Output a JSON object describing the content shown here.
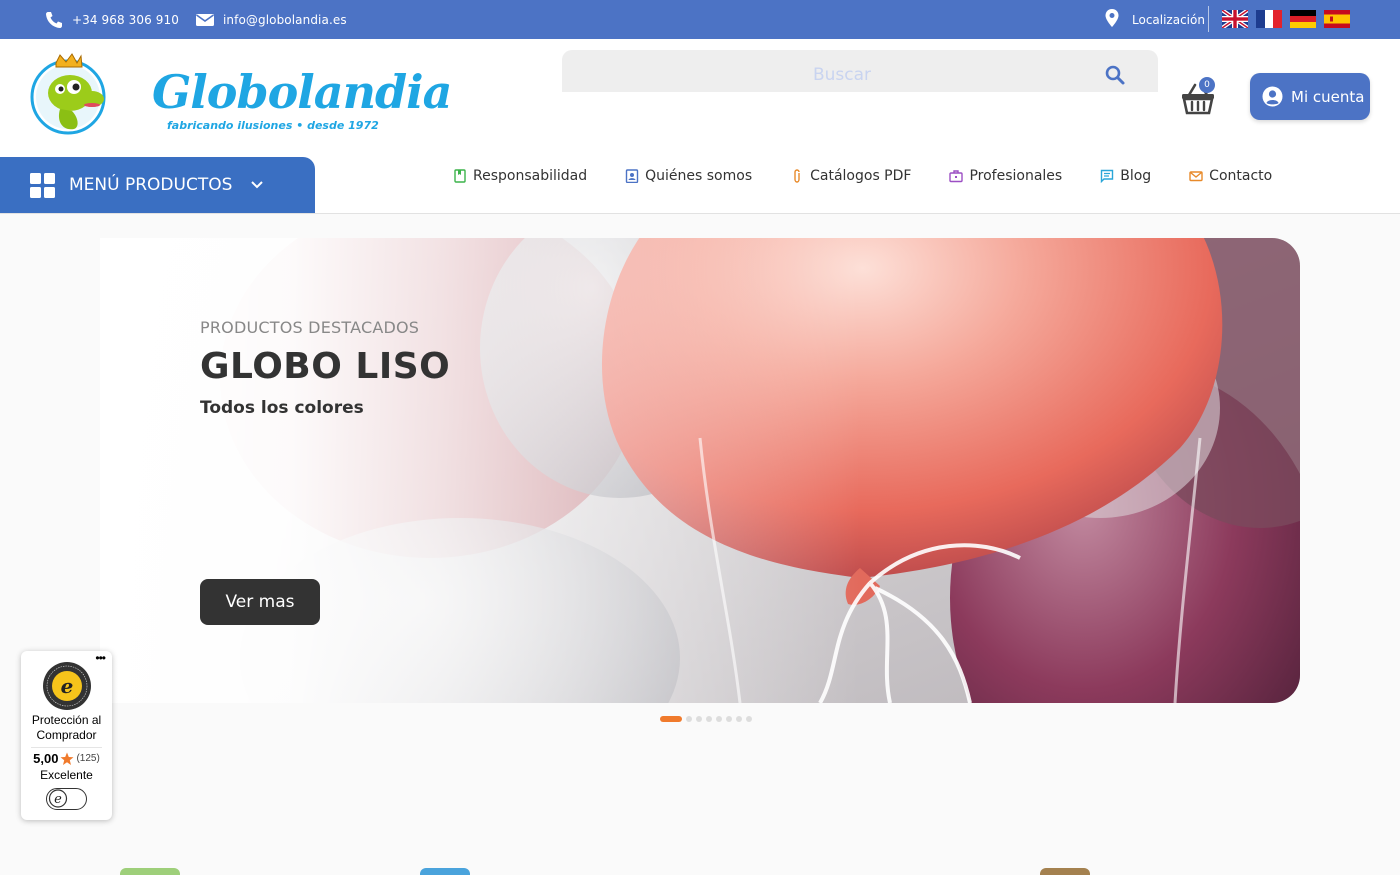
{
  "topbar": {
    "phone": "+34 968 306 910",
    "email": "info@globolandia.es",
    "location_label": "Localización",
    "languages": [
      "en",
      "fr",
      "de",
      "es"
    ]
  },
  "header": {
    "logo_text": "Globolandia",
    "logo_tagline": "fabricando ilusiones • desde 1972",
    "search_placeholder": "Buscar",
    "cart_count": "0",
    "account_label": "Mi cuenta",
    "menu_products_label": "MENÚ PRODUCTOS"
  },
  "nav": {
    "items": [
      {
        "label": "Responsabilidad",
        "icon": "book-icon",
        "color": "#3bb34a"
      },
      {
        "label": "Quiénes somos",
        "icon": "id-card-icon",
        "color": "#4c73c5"
      },
      {
        "label": "Catálogos PDF",
        "icon": "paperclip-icon",
        "color": "#e88a2a"
      },
      {
        "label": "Profesionales",
        "icon": "briefcase-icon",
        "color": "#9c4fc4"
      },
      {
        "label": "Blog",
        "icon": "comment-icon",
        "color": "#2aa6d8"
      },
      {
        "label": "Contacto",
        "icon": "envelope-icon",
        "color": "#e88a2a"
      }
    ]
  },
  "hero": {
    "kicker": "PRODUCTOS DESTACADOS",
    "title": "GLOBO LISO",
    "subtitle": "Todos los colores",
    "cta_label": "Ver mas",
    "slide_count": 8,
    "active_slide": 1
  },
  "trust_badge": {
    "protection_label": "Protección al Comprador",
    "score": "5,00",
    "reviews": "(125)",
    "grade": "Excelente"
  },
  "colors": {
    "brand_blue": "#4c73c5",
    "menu_blue": "#3a6fc2",
    "logo_cyan": "#1fa6e3",
    "accent_orange": "#f07a2c"
  }
}
